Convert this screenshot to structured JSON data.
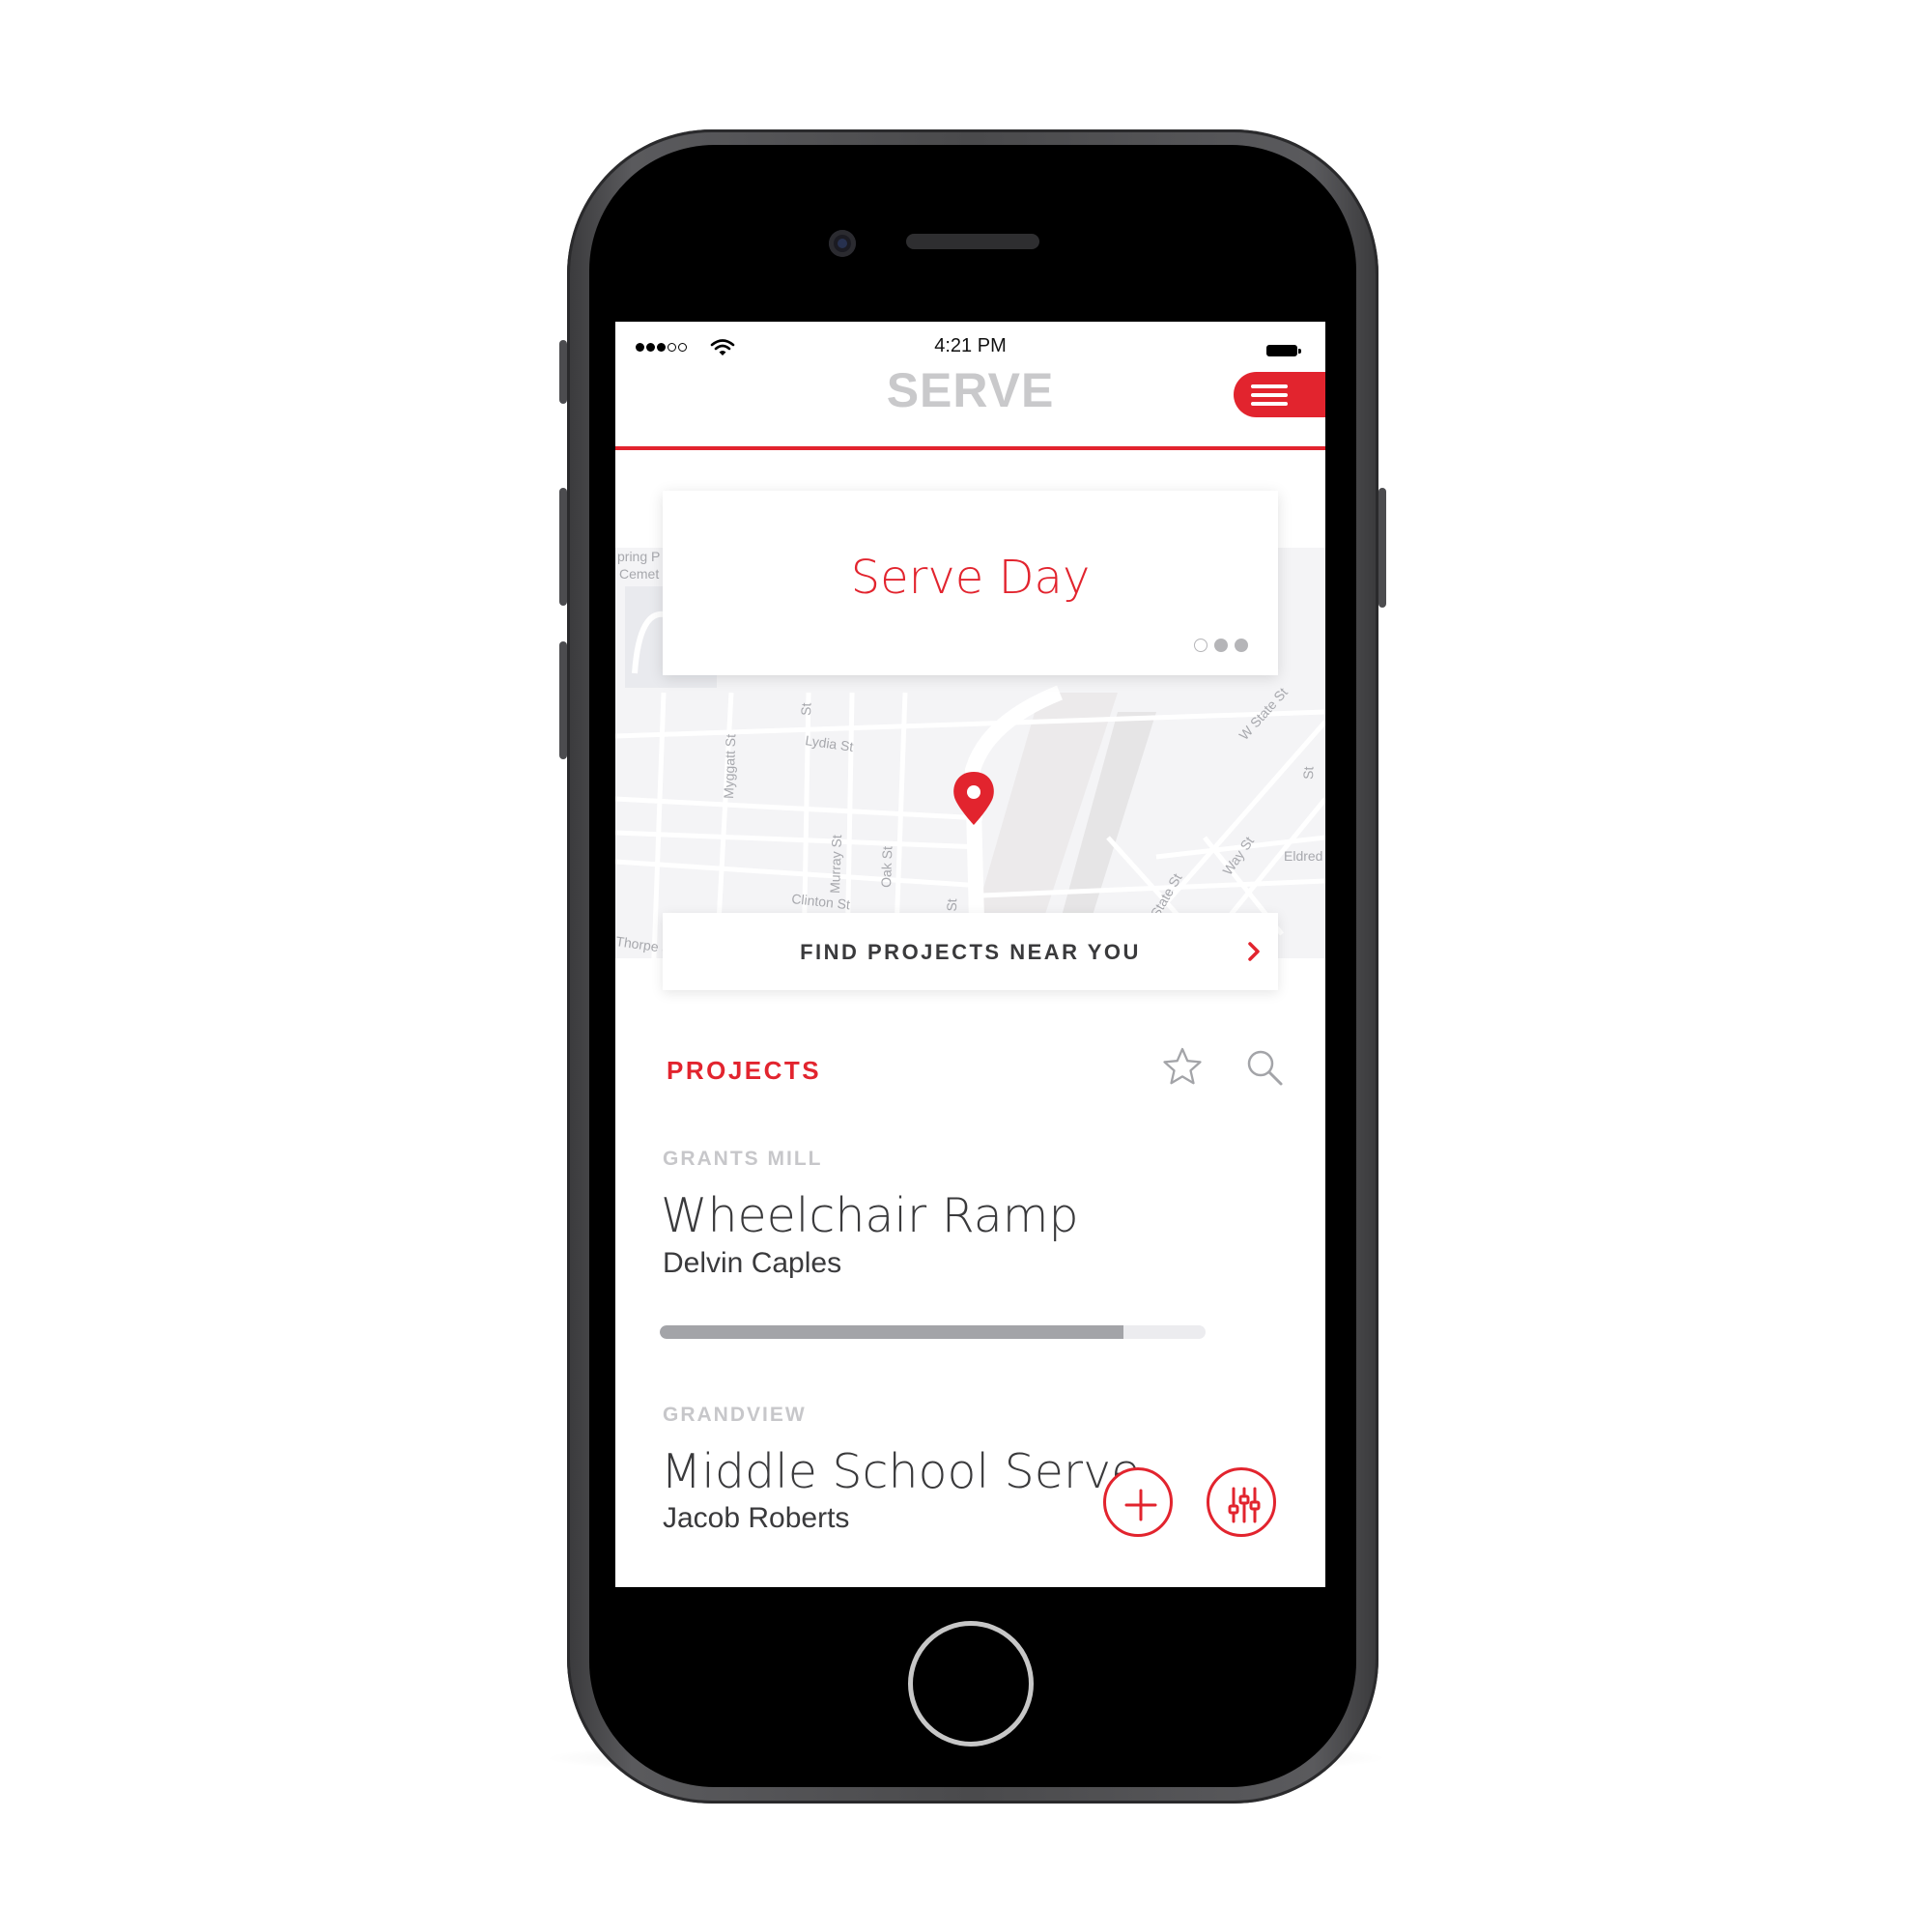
{
  "status_bar": {
    "time": "4:21 PM",
    "signal_bars": 3,
    "signal_total": 5
  },
  "header": {
    "title": "SERVE",
    "menu_icon": "hamburger-icon"
  },
  "featured": {
    "title": "Serve Day",
    "carousel_dots": 3,
    "active_dot": 0
  },
  "map": {
    "street_labels": [
      "Lydia St",
      "Myggatt St",
      "Murray St",
      "Oak St",
      "Clinton St",
      "W State St",
      "State St",
      "Way St",
      "Eldred",
      "Thorpe S",
      "ont St",
      "St",
      "St",
      "pring P",
      "Cemet"
    ],
    "pin_icon": "location-pin-icon"
  },
  "find_projects": {
    "label": "FIND PROJECTS NEAR YOU",
    "icon": "chevron-right-icon"
  },
  "projects": {
    "section_label": "PROJECTS",
    "favorites_icon": "star-icon",
    "search_icon": "search-icon",
    "items": [
      {
        "campus": "GRANTS MILL",
        "title": "Wheelchair Ramp",
        "leader": "Delvin Caples",
        "progress": 0.85
      },
      {
        "campus": "GRANDVIEW",
        "title": "Middle School Serve",
        "leader": "Jacob Roberts"
      }
    ]
  },
  "actions": {
    "add_icon": "plus-icon",
    "filter_icon": "sliders-icon"
  },
  "colors": {
    "accent": "#e2242e",
    "muted_title": "#c9c9cb",
    "text": "#3a3a3c",
    "progress_fill": "#a3a4a8"
  }
}
